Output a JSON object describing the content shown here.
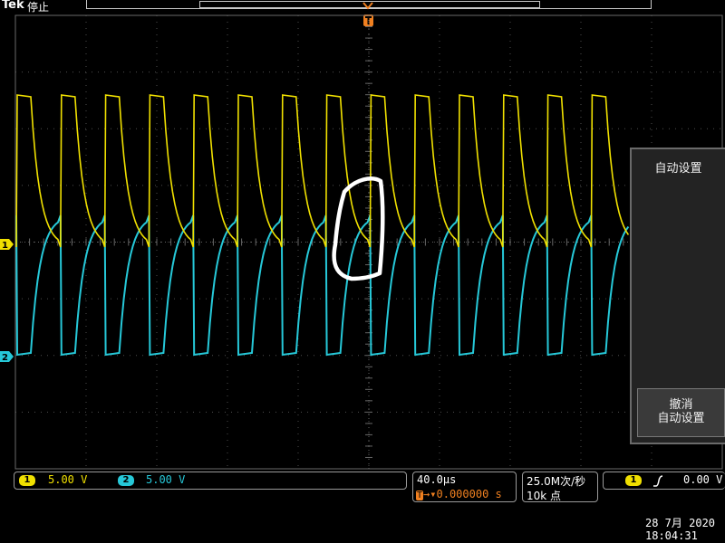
{
  "brand": "Tek",
  "run_status": "停止",
  "menu": {
    "title": "自动设置",
    "undo_line1": "撤消",
    "undo_line2": "自动设置"
  },
  "channels": {
    "ch1": {
      "number": "1",
      "scale": "5.00 V",
      "color": "#f0e000"
    },
    "ch2": {
      "number": "2",
      "scale": "5.00 V",
      "color": "#26c8d8"
    }
  },
  "timebase": {
    "scale": "40.0µs",
    "trigger_position": "0.000000 s"
  },
  "acquisition": {
    "sample_rate": "25.0M次/秒",
    "record_length": "10k 点"
  },
  "trigger": {
    "source": "1",
    "slope_icon": "rising-edge-icon",
    "level": "0.00 V"
  },
  "datetime": {
    "date": "28 7月  2020",
    "time": "18:04:31"
  },
  "annotation_letter": "D"
}
